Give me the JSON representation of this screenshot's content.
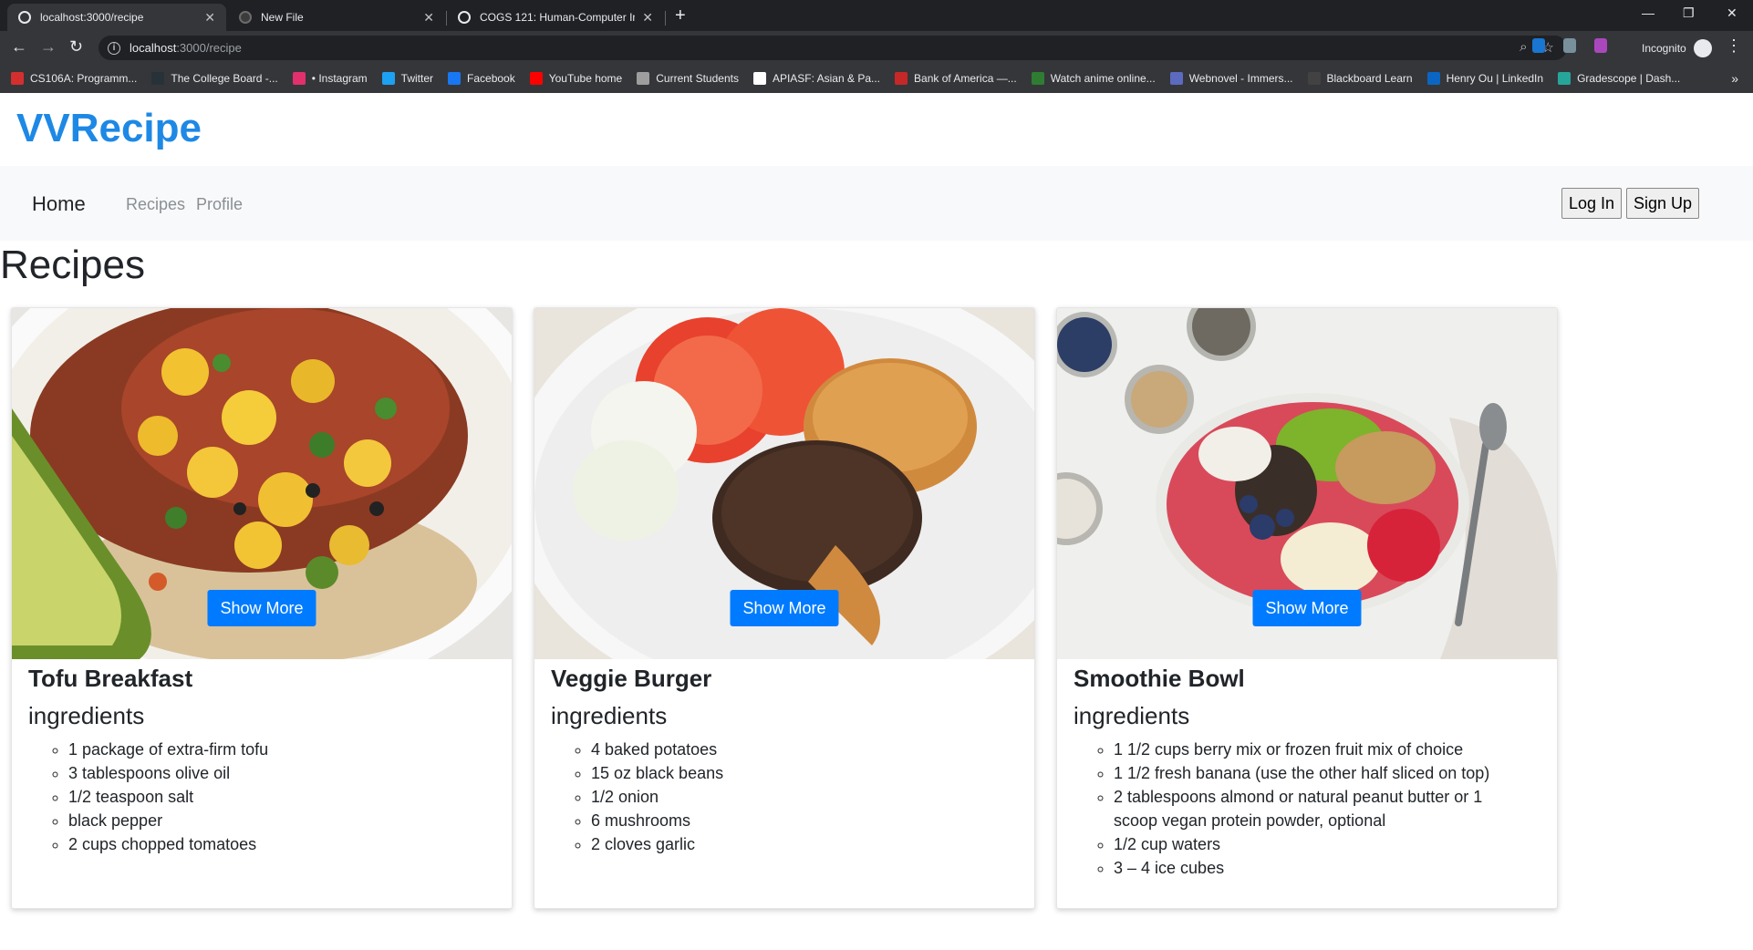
{
  "browser": {
    "tabs": [
      {
        "title": "localhost:3000/recipe",
        "active": true
      },
      {
        "title": "New File",
        "active": false
      },
      {
        "title": "COGS 121: Human-Computer Int",
        "active": false
      }
    ],
    "url_host": "localhost",
    "url_path": ":3000/recipe",
    "profile_label": "Incognito",
    "bookmarks": [
      {
        "label": "CS106A: Programm...",
        "color": "#d32f2f"
      },
      {
        "label": "The College Board -...",
        "color": "#263238"
      },
      {
        "label": "• Instagram",
        "color": "#e1306c"
      },
      {
        "label": "Twitter",
        "color": "#1da1f2"
      },
      {
        "label": "Facebook",
        "color": "#1877f2"
      },
      {
        "label": "YouTube home",
        "color": "#ff0000"
      },
      {
        "label": "Current Students",
        "color": "#9e9e9e"
      },
      {
        "label": "APIASF: Asian & Pa...",
        "color": "#ffffff"
      },
      {
        "label": "Bank of America —...",
        "color": "#c62828"
      },
      {
        "label": "Watch anime online...",
        "color": "#2e7d32"
      },
      {
        "label": "Webnovel - Immers...",
        "color": "#5c6bc0"
      },
      {
        "label": "Blackboard Learn",
        "color": "#424242"
      },
      {
        "label": "Henry Ou | LinkedIn",
        "color": "#0a66c2"
      },
      {
        "label": "Gradescope | Dash...",
        "color": "#26a69a"
      }
    ]
  },
  "site": {
    "brand": "VVRecipe",
    "nav": {
      "home": "Home",
      "recipes": "Recipes",
      "profile": "Profile"
    },
    "auth": {
      "login": "Log In",
      "signup": "Sign Up"
    },
    "heading": "Recipes",
    "accent_color": "#1e88e5",
    "button_color": "#007bff"
  },
  "recipes": [
    {
      "title": "Tofu Breakfast",
      "subtitle": "ingredients",
      "button": "Show More",
      "ingredients": [
        "1 package of extra-firm tofu",
        "3 tablespoons olive oil",
        "1/2 teaspoon salt",
        "black pepper",
        "2 cups chopped tomatoes"
      ]
    },
    {
      "title": "Veggie Burger",
      "subtitle": "ingredients",
      "button": "Show More",
      "ingredients": [
        "4 baked potatoes",
        "15 oz black beans",
        "1/2 onion",
        "6 mushrooms",
        "2 cloves garlic"
      ]
    },
    {
      "title": "Smoothie Bowl",
      "subtitle": "ingredients",
      "button": "Show More",
      "ingredients": [
        "1 1/2 cups berry mix or frozen fruit mix of choice",
        "1 1/2 fresh banana (use the other half sliced on top)",
        "2 tablespoons almond or natural peanut butter or 1 scoop vegan protein powder, optional",
        "1/2 cup waters",
        "3 – 4 ice cubes"
      ]
    }
  ]
}
